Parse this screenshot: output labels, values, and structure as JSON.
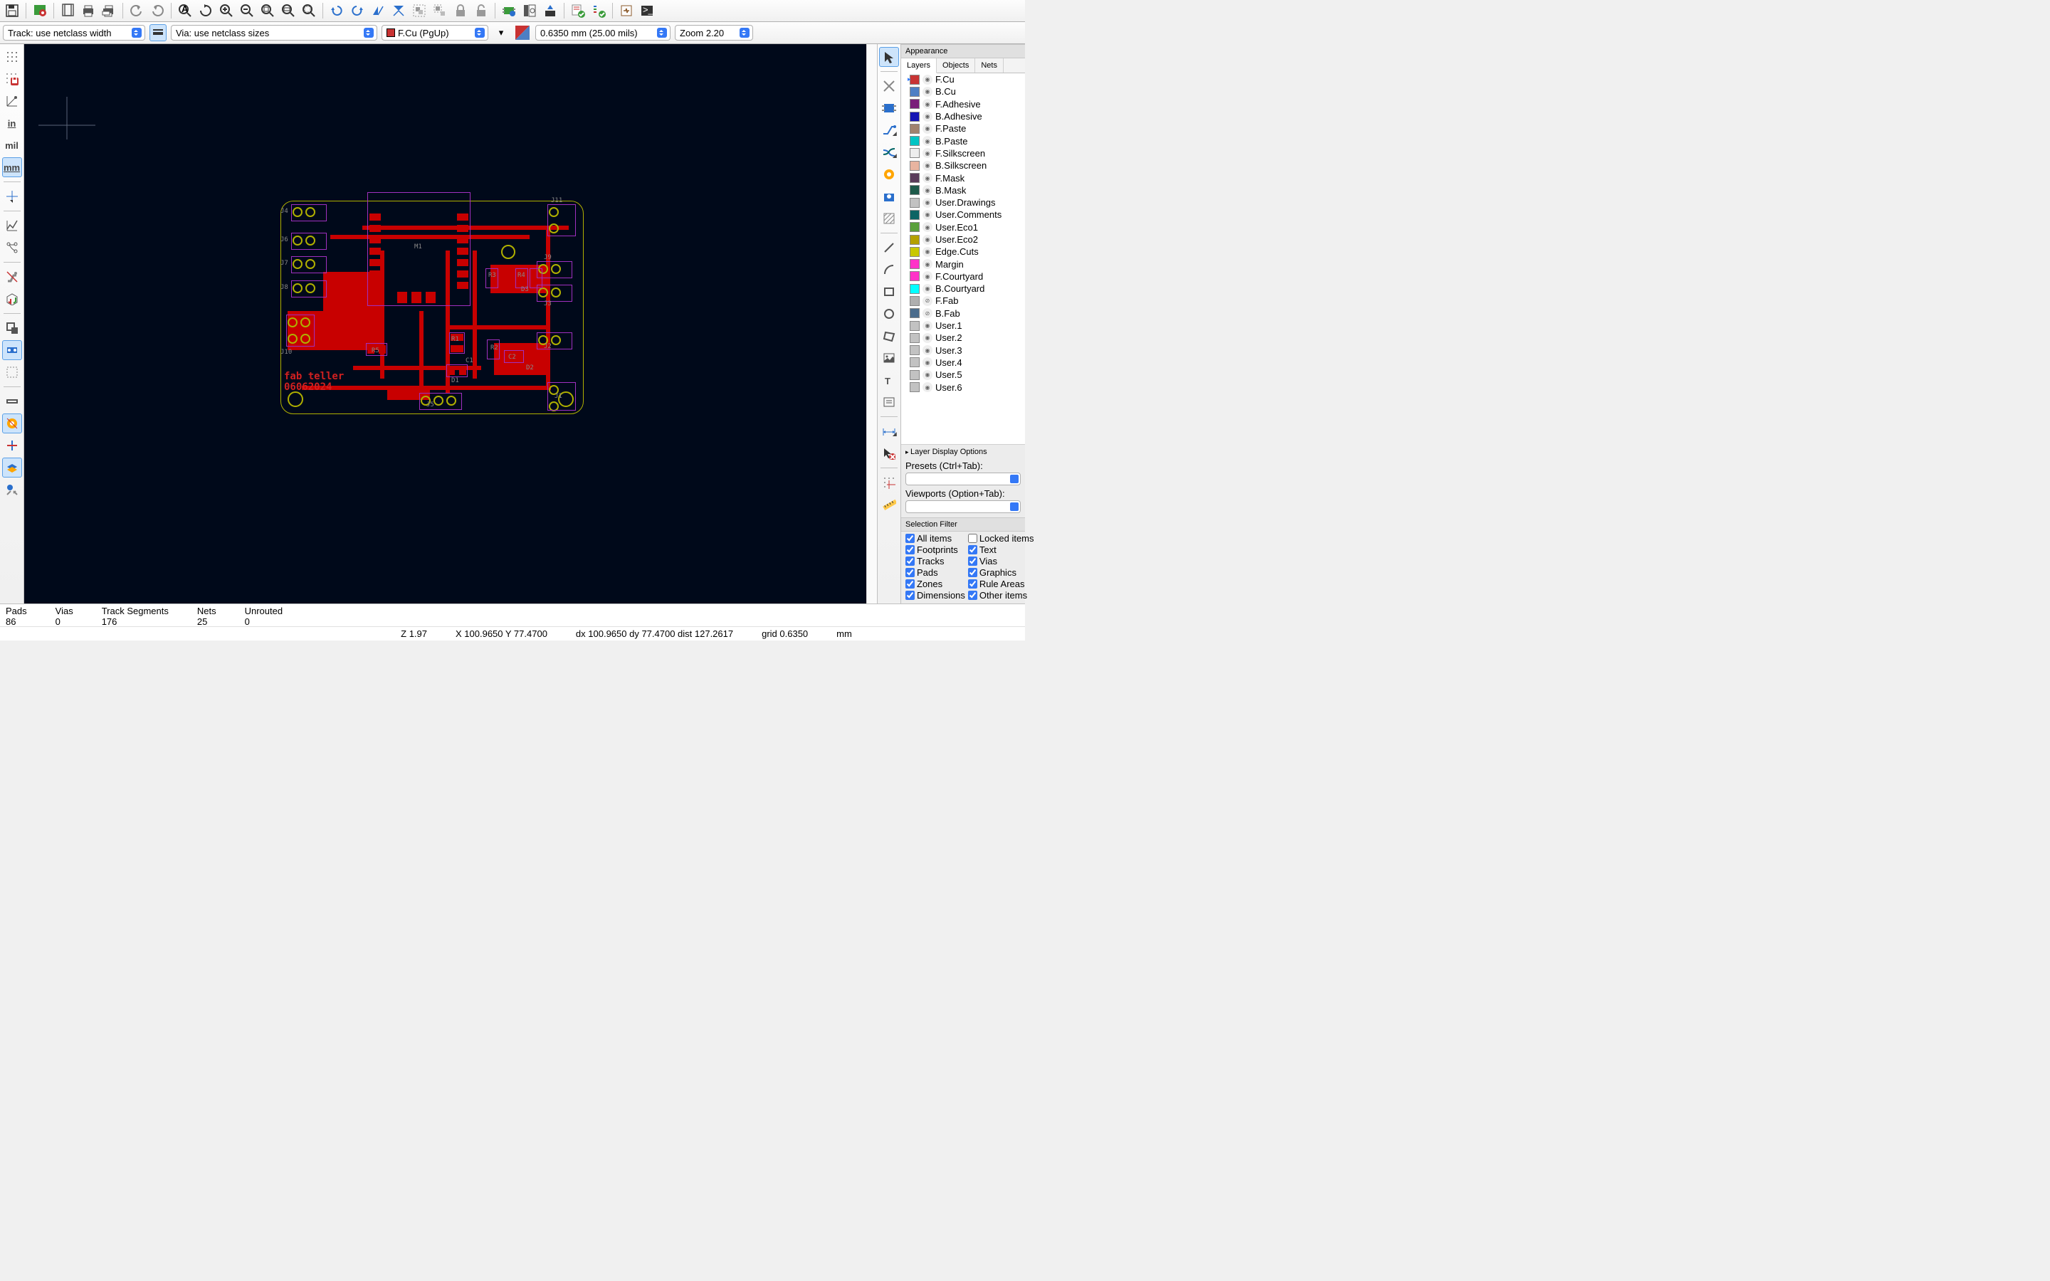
{
  "toolbars": {
    "track_dd": "Track: use netclass width",
    "via_dd": "Via: use netclass sizes",
    "layer_dd": "F.Cu (PgUp)",
    "grid_dd": "0.6350 mm (25.00 mils)",
    "zoom_dd": "Zoom 2.20"
  },
  "left_toolbar": {
    "in": "in",
    "mil": "mil",
    "mm": "mm"
  },
  "appearance": {
    "title": "Appearance",
    "tabs": [
      "Layers",
      "Objects",
      "Nets"
    ],
    "layers": [
      {
        "name": "F.Cu",
        "color": "#c83434",
        "current": true
      },
      {
        "name": "B.Cu",
        "color": "#4d7fc4"
      },
      {
        "name": "F.Adhesive",
        "color": "#7a1e7a"
      },
      {
        "name": "B.Adhesive",
        "color": "#1414b4"
      },
      {
        "name": "F.Paste",
        "color": "#a0826e"
      },
      {
        "name": "B.Paste",
        "color": "#00c4c4"
      },
      {
        "name": "F.Silkscreen",
        "color": "#eeeeee"
      },
      {
        "name": "B.Silkscreen",
        "color": "#e8b4a0"
      },
      {
        "name": "F.Mask",
        "color": "#5a3c5a"
      },
      {
        "name": "B.Mask",
        "color": "#1e5a4a"
      },
      {
        "name": "User.Drawings",
        "color": "#c2c2c2"
      },
      {
        "name": "User.Comments",
        "color": "#0c6464"
      },
      {
        "name": "User.Eco1",
        "color": "#5aa03c"
      },
      {
        "name": "User.Eco2",
        "color": "#b4a000"
      },
      {
        "name": "Edge.Cuts",
        "color": "#c8c800"
      },
      {
        "name": "Margin",
        "color": "#ff32c8"
      },
      {
        "name": "F.Courtyard",
        "color": "#ff32c8"
      },
      {
        "name": "B.Courtyard",
        "color": "#00ffff"
      },
      {
        "name": "F.Fab",
        "color": "#afafaf",
        "disabled": true
      },
      {
        "name": "B.Fab",
        "color": "#4b6c8c",
        "disabled": true
      },
      {
        "name": "User.1",
        "color": "#c2c2c2"
      },
      {
        "name": "User.2",
        "color": "#c2c2c2"
      },
      {
        "name": "User.3",
        "color": "#c2c2c2"
      },
      {
        "name": "User.4",
        "color": "#c2c2c2"
      },
      {
        "name": "User.5",
        "color": "#c2c2c2"
      },
      {
        "name": "User.6",
        "color": "#c2c2c2"
      }
    ],
    "layer_display_options": "Layer Display Options",
    "presets_label": "Presets (Ctrl+Tab):",
    "viewports_label": "Viewports (Option+Tab):"
  },
  "selection_filter": {
    "title": "Selection Filter",
    "items_left": [
      "All items",
      "Footprints",
      "Tracks",
      "Pads",
      "Zones",
      "Dimensions"
    ],
    "items_right": [
      "Locked items",
      "Text",
      "Vias",
      "Graphics",
      "Rule Areas",
      "Other items"
    ],
    "locked_checked": false
  },
  "status": {
    "cols": [
      {
        "h": "Pads",
        "v": "86"
      },
      {
        "h": "Vias",
        "v": "0"
      },
      {
        "h": "Track Segments",
        "v": "176"
      },
      {
        "h": "Nets",
        "v": "25"
      },
      {
        "h": "Unrouted",
        "v": "0"
      }
    ],
    "z": "Z 1.97",
    "xy": "X 100.9650  Y 77.4700",
    "dxy": "dx 100.9650  dy 77.4700  dist 127.2617",
    "grid": "grid 0.6350",
    "units": "mm"
  },
  "pcb": {
    "silk_line1": "fab teller",
    "silk_line2": "06062024",
    "refs": [
      "J4",
      "J6",
      "J7",
      "J8",
      "J10",
      "J11",
      "J9",
      "J3",
      "J2",
      "J1",
      "J5",
      "M1",
      "R1",
      "R2",
      "R3",
      "R4",
      "R5",
      "D1",
      "D2",
      "D3",
      "C1",
      "C2"
    ]
  }
}
